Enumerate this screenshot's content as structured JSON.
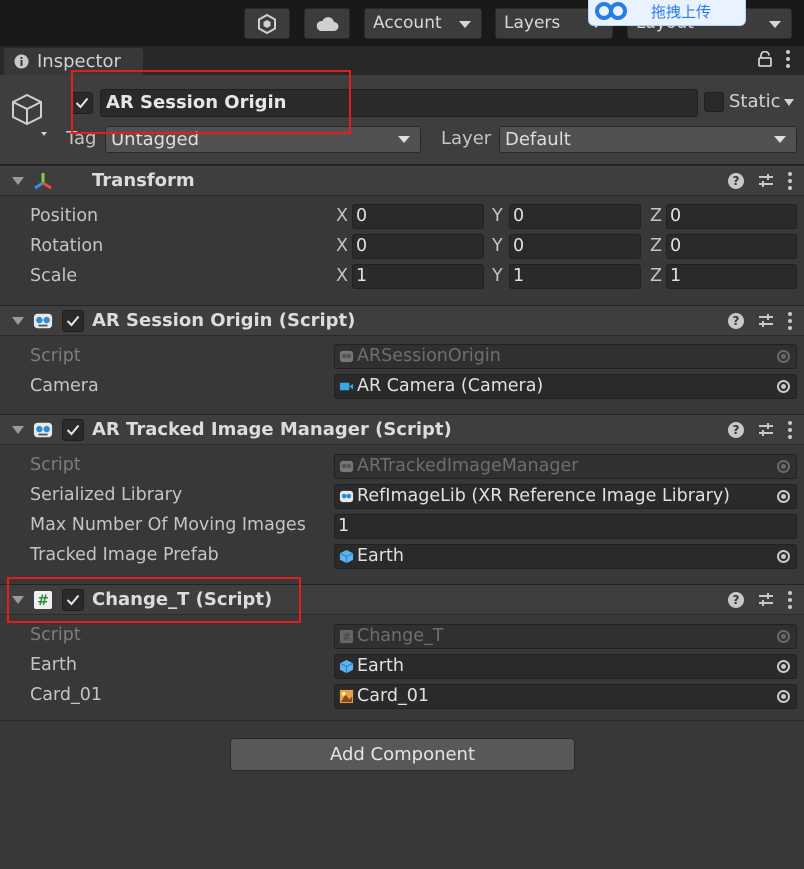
{
  "toolbar": {
    "account_label": "Account",
    "layers_label": "Layers",
    "layout_label": "Layout",
    "overlay_text": "拖拽上传",
    "icons": [
      "plastic-scm-icon",
      "cloud-icon"
    ]
  },
  "tab": {
    "label": "Inspector"
  },
  "game_object": {
    "name": "AR Session Origin",
    "static_label": "Static",
    "tag_label": "Tag",
    "tag_value": "Untagged",
    "layer_label": "Layer",
    "layer_value": "Default"
  },
  "transform": {
    "title": "Transform",
    "rows": [
      {
        "label": "Position",
        "x": "0",
        "y": "0",
        "z": "0"
      },
      {
        "label": "Rotation",
        "x": "0",
        "y": "0",
        "z": "0"
      },
      {
        "label": "Scale",
        "x": "1",
        "y": "1",
        "z": "1"
      }
    ],
    "axis_x": "X",
    "axis_y": "Y",
    "axis_z": "Z"
  },
  "ar_session_origin": {
    "title": "AR Session Origin (Script)",
    "script_label": "Script",
    "script_value": "ARSessionOrigin",
    "camera_label": "Camera",
    "camera_value": "AR Camera (Camera)"
  },
  "ar_tracked": {
    "title": "AR Tracked Image Manager (Script)",
    "script_label": "Script",
    "script_value": "ARTrackedImageManager",
    "library_label": "Serialized Library",
    "library_value": "RefImageLib (XR Reference Image Library)",
    "max_label": "Max Number Of Moving Images",
    "max_value": "1",
    "prefab_label": "Tracked Image Prefab",
    "prefab_value": "Earth"
  },
  "change_t": {
    "title": "Change_T (Script)",
    "script_label": "Script",
    "script_value": "Change_T",
    "earth_label": "Earth",
    "earth_value": "Earth",
    "card_label": "Card_01",
    "card_value": "Card_01"
  },
  "add_component_label": "Add Component",
  "colors": {
    "highlight_box": "#e02020",
    "panel_bg": "#383838",
    "header_bg": "#3e3e3e"
  }
}
